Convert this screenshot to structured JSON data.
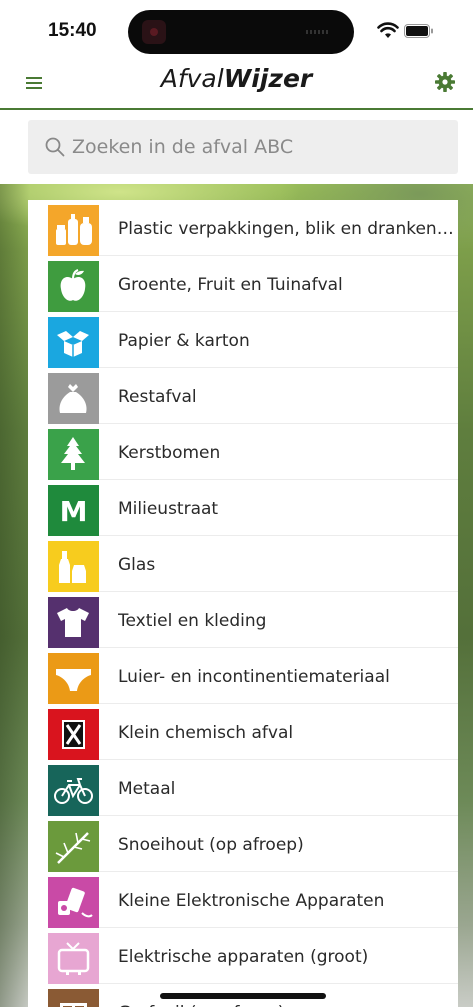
{
  "status_bar": {
    "time": "15:40"
  },
  "header": {
    "title_part1": "Afval",
    "title_part2": "Wijzer",
    "accent_color": "#4a7a34"
  },
  "search": {
    "placeholder": "Zoeken in de afval ABC"
  },
  "categories": [
    {
      "label": "Plastic verpakkingen, blik en drankenkarto...",
      "icon": "plastic-bottles-icon",
      "color": "#f4a62a"
    },
    {
      "label": "Groente, Fruit en Tuinafval",
      "icon": "apple-icon",
      "color": "#3f9c3f"
    },
    {
      "label": "Papier & karton",
      "icon": "open-box-icon",
      "color": "#1aa7e0"
    },
    {
      "label": "Restafval",
      "icon": "trash-bag-icon",
      "color": "#9b9b9b"
    },
    {
      "label": "Kerstbomen",
      "icon": "christmas-tree-icon",
      "color": "#3aa24a"
    },
    {
      "label": "Milieustraat",
      "icon": "letter-m-icon",
      "color": "#1f8a3c",
      "glyph": "M"
    },
    {
      "label": "Glas",
      "icon": "glass-bottle-icon",
      "color": "#f7cc1e"
    },
    {
      "label": "Textiel en kleding",
      "icon": "tshirt-icon",
      "color": "#55306e"
    },
    {
      "label": "Luier- en incontinentiemateriaal",
      "icon": "diaper-icon",
      "color": "#eb9a16"
    },
    {
      "label": "Klein chemisch afval",
      "icon": "hazard-icon",
      "color": "#d9141e"
    },
    {
      "label": "Metaal",
      "icon": "bicycle-icon",
      "color": "#17655a"
    },
    {
      "label": "Snoeihout (op afroep)",
      "icon": "branch-icon",
      "color": "#6b9a3c"
    },
    {
      "label": "Kleine Elektronische Apparaten",
      "icon": "small-appliance-icon",
      "color": "#c94aa6"
    },
    {
      "label": "Elektrische apparaten (groot)",
      "icon": "tv-icon",
      "color": "#e7a6d2"
    },
    {
      "label": "Grofvuil (op afroep)",
      "icon": "furniture-icon",
      "color": "#8a5a34"
    }
  ]
}
